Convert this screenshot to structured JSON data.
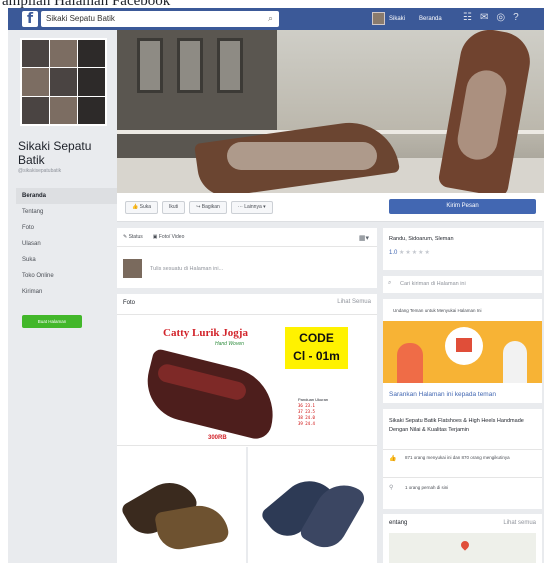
{
  "caption": "ampilan Halaman Facebook",
  "topbar": {
    "search_value": "Sikaki Sepatu Batik",
    "user_name": "Sikaki",
    "home_label": "Beranda"
  },
  "page": {
    "name_line1": "Sikaki Sepatu",
    "name_line2": "Batik",
    "handle": "@sikakisepatubatik"
  },
  "nav": {
    "items": [
      {
        "label": "Beranda",
        "active": true
      },
      {
        "label": "Tentang"
      },
      {
        "label": "Foto"
      },
      {
        "label": "Ulasan"
      },
      {
        "label": "Suka"
      },
      {
        "label": "Toko Online"
      },
      {
        "label": "Kiriman"
      }
    ],
    "promote_label": "Buat Halaman"
  },
  "actions": {
    "like": "👍 Suka",
    "follow": "Ikuti",
    "share": "↪ Bagikan",
    "more": "··· Lainnya ▾",
    "send": "Kirim Pesan"
  },
  "composer": {
    "status_tab": "✎ Status",
    "photo_tab": "▣ Foto/ Video",
    "placeholder": "Tulis sesuatu di Halaman ini..."
  },
  "photos": {
    "title": "Foto",
    "see_all": "Lihat Semua",
    "brand": "Catty Lurik Jogja",
    "brand_sub": "Hand Woven",
    "code_line1": "CODE",
    "code_line2": "Cl - 01m",
    "sizes_head": "Panduan Ukuran",
    "sizes": [
      "36   23.1",
      "37   23.5",
      "38   24.0",
      "39   24.4"
    ],
    "price": "300RB"
  },
  "sidebar": {
    "place": "Randu, Sidoarum, Sleman",
    "rating": "1.0",
    "stars": "★★★★★",
    "search_placeholder": "Cari kiriman di Halaman ini",
    "invite_text": "Undang Teman untuk Menyukai Halaman Ini",
    "invite_cta": "Sarankan Halaman ini kepada teman",
    "about_desc": "Sikaki Sepatu Batik Flatshoes & High Heels Handmade Dengan Nilai & Kualitas Terjamin",
    "likes_text": "871 orang menyukai ini dan 870 orang mengikutinya",
    "checkins_text": "1 orang pernah di sini",
    "map_title": "entang",
    "map_see_all": "Lihat semua"
  },
  "colors": {
    "facebook_blue": "#3b5998",
    "accent_blue": "#4267b2",
    "promote_green": "#42b72a",
    "code_yellow": "#fff200",
    "brand_red": "#d2232a"
  }
}
